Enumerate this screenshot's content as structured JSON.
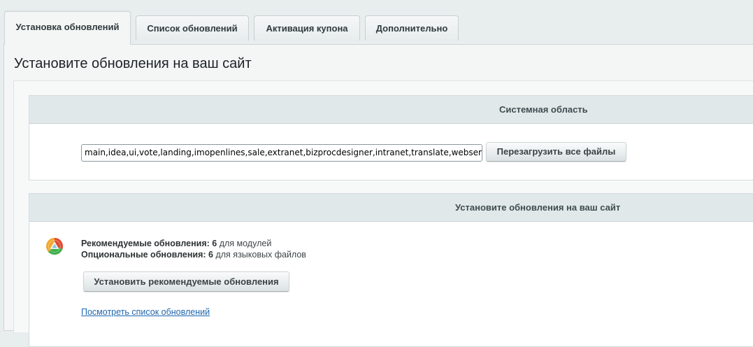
{
  "tabs": [
    {
      "label": "Установка обновлений",
      "active": true
    },
    {
      "label": "Список обновлений",
      "active": false
    },
    {
      "label": "Активация купона",
      "active": false
    },
    {
      "label": "Дополнительно",
      "active": false
    }
  ],
  "page": {
    "title": "Установите обновления на ваш сайт"
  },
  "system_area": {
    "header": "Системная область",
    "modules_value": "main,idea,ui,vote,landing,imopenlines,sale,extranet,bizprocdesigner,intranet,translate,webservice,",
    "reload_button": "Перезагрузить все файлы"
  },
  "install_section": {
    "header": "Установите обновления на ваш сайт",
    "icon": "updates-icon",
    "recommended_label": "Рекомендуемые обновления:",
    "recommended_count": "6",
    "recommended_suffix": "для модулей",
    "optional_label": "Опциональные обновления:",
    "optional_count": "6",
    "optional_suffix": "для языковых файлов",
    "install_button": "Установить рекомендуемые обновления",
    "view_list_link": "Посмотреть список обновлений"
  },
  "colors": {
    "background": "#e8edee",
    "section_header": "#e0e8ea",
    "link": "#2067b0"
  }
}
